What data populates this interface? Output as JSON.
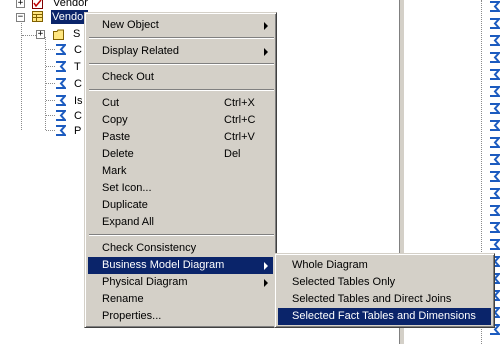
{
  "tree": {
    "top_item_label": "Vendor",
    "selected_item_label": "Vendor",
    "children": [
      {
        "label": "S",
        "icon": "folder-icon"
      },
      {
        "label": "C",
        "icon": "column-icon"
      },
      {
        "label": "T",
        "icon": "column-icon"
      },
      {
        "label": "C",
        "icon": "column-icon"
      },
      {
        "label": "Is",
        "icon": "column-icon"
      },
      {
        "label": "C",
        "icon": "column-icon"
      },
      {
        "label": "P",
        "icon": "column-icon"
      }
    ]
  },
  "context_menu": {
    "items": [
      {
        "label": "New Object",
        "shortcut": "",
        "submenu": true
      },
      {
        "label": "Display Related",
        "shortcut": "",
        "submenu": true
      },
      {
        "label": "Check Out",
        "shortcut": ""
      },
      {
        "label": "Cut",
        "shortcut": "Ctrl+X"
      },
      {
        "label": "Copy",
        "shortcut": "Ctrl+C"
      },
      {
        "label": "Paste",
        "shortcut": "Ctrl+V"
      },
      {
        "label": "Delete",
        "shortcut": "Del"
      },
      {
        "label": "Mark",
        "shortcut": ""
      },
      {
        "label": "Set Icon...",
        "shortcut": ""
      },
      {
        "label": "Duplicate",
        "shortcut": ""
      },
      {
        "label": "Expand All",
        "shortcut": ""
      },
      {
        "label": "Check Consistency",
        "shortcut": ""
      },
      {
        "label": "Business Model Diagram",
        "shortcut": "",
        "submenu": true,
        "highlighted": true
      },
      {
        "label": "Physical Diagram",
        "shortcut": "",
        "submenu": true
      },
      {
        "label": "Rename",
        "shortcut": ""
      },
      {
        "label": "Properties...",
        "shortcut": ""
      }
    ]
  },
  "submenu": {
    "items": [
      {
        "label": "Whole Diagram"
      },
      {
        "label": "Selected Tables Only"
      },
      {
        "label": "Selected Tables and Direct Joins"
      },
      {
        "label": "Selected Fact Tables and Dimensions",
        "highlighted": true
      }
    ]
  },
  "colors": {
    "menu_bg": "#d4d0c8",
    "highlight": "#0a246a",
    "column_icon": "#1c5bbf"
  }
}
